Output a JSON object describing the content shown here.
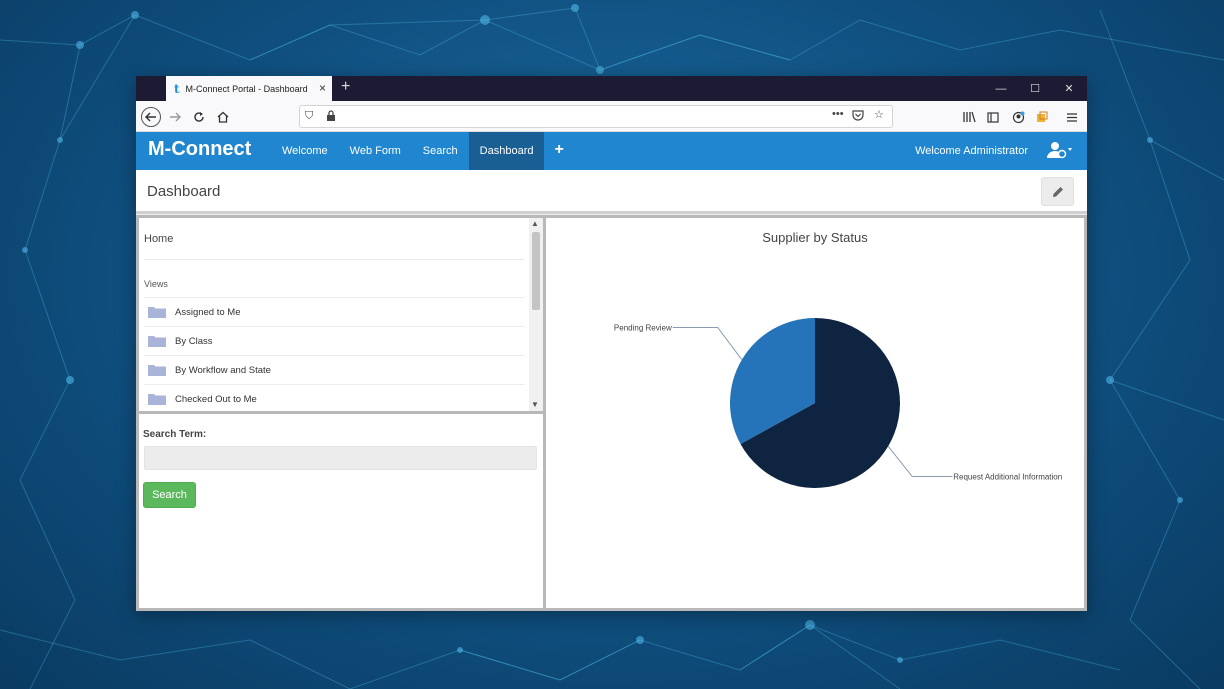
{
  "browser": {
    "tab_title": "M-Connect Portal - Dashboard",
    "favicon": "t",
    "new_tab": "+",
    "controls": {
      "minimize": "—",
      "maximize": "☐",
      "close": "✕"
    }
  },
  "app": {
    "brand": "M-Connect",
    "menu": [
      {
        "label": "Welcome",
        "active": false
      },
      {
        "label": "Web Form",
        "active": false
      },
      {
        "label": "Search",
        "active": false
      },
      {
        "label": "Dashboard",
        "active": true
      }
    ],
    "add_label": "+",
    "welcome_text": "Welcome Administrator"
  },
  "page": {
    "title": "Dashboard"
  },
  "left_panel": {
    "home": "Home",
    "views_heading": "Views",
    "views": [
      "Assigned to Me",
      "By Class",
      "By Workflow and State",
      "Checked Out to Me"
    ]
  },
  "search": {
    "label": "Search Term:",
    "value": "",
    "button": "Search"
  },
  "colors": {
    "app_blue": "#1f86cf",
    "active_tab": "#195f94",
    "pie_dark": "#0e2440",
    "pie_light": "#2574b9",
    "search_green": "#5cb85c"
  },
  "chart_data": {
    "type": "pie",
    "title": "Supplier by Status",
    "slices": [
      {
        "label": "Request Additional Information",
        "value": 67,
        "color": "#0e2440"
      },
      {
        "label": "Pending Review",
        "value": 33,
        "color": "#2574b9"
      }
    ]
  }
}
